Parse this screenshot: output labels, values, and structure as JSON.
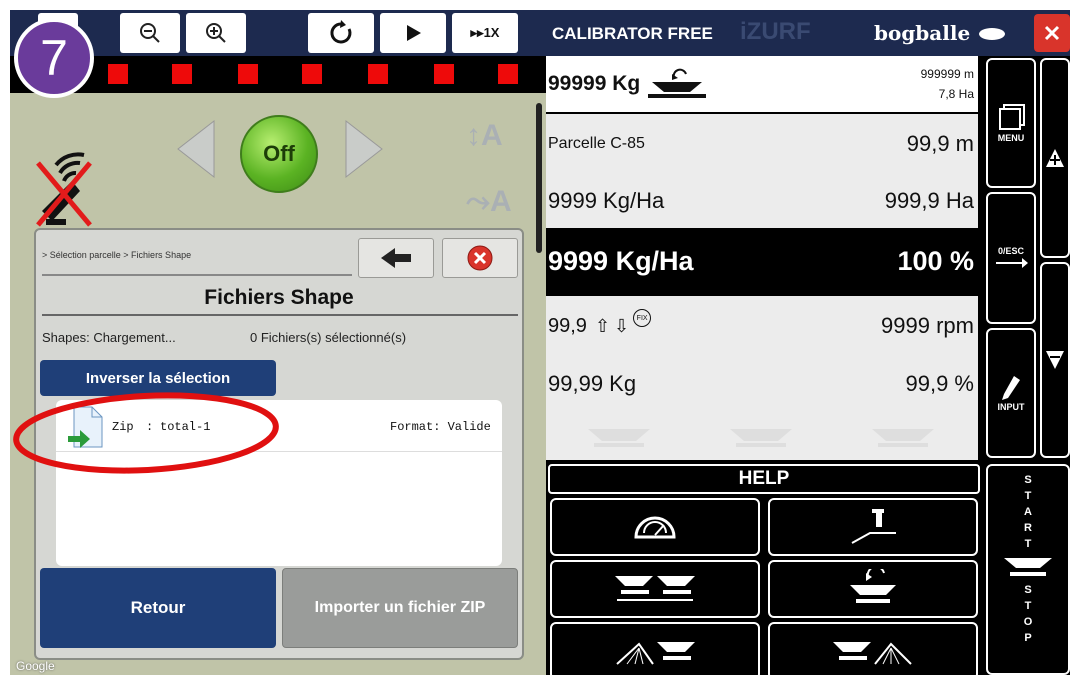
{
  "toolbar": {
    "speed_label": "▸▸1X"
  },
  "step_badge": "7",
  "map": {
    "off_label": "Off",
    "google_label": "Google"
  },
  "dialog": {
    "breadcrumb": "> Sélection parcelle > Fichiers Shape",
    "title": "Fichiers Shape",
    "status": "Shapes: Chargement...",
    "selected_count": "0 Fichiers(s) sélectionné(s)",
    "invert_label": "Inverser la sélection",
    "file": {
      "type": "Zip",
      "sep": ":",
      "name": "total-1",
      "format": "Format: Valide"
    },
    "back_label": "Retour",
    "import_label": "Importer un fichier ZIP"
  },
  "header": {
    "app_title": "CALIBRATOR FREE",
    "watermark": "iZURF",
    "brand": "bogballe"
  },
  "readouts": {
    "weight": "99999 Kg",
    "distance_top": "999999 m",
    "area_top": "7,8 Ha",
    "parcel": "Parcelle C-85",
    "parcel_distance": "99,9 m",
    "rate": "9999 Kg/Ha",
    "area": "999,9 Ha",
    "target_rate": "9999 Kg/Ha",
    "target_percent": "100 %",
    "setting": "99,9",
    "fix": "FIX",
    "rpm": "9999 rpm",
    "applied": "99,99 Kg",
    "applied_percent": "99,9 %"
  },
  "side_buttons": {
    "menu": "MENU",
    "esc": "0/ESC",
    "input": "INPUT"
  },
  "help": {
    "label": "HELP"
  },
  "startstop": [
    "S",
    "T",
    "A",
    "R",
    "T",
    "S",
    "T",
    "O",
    "P"
  ]
}
